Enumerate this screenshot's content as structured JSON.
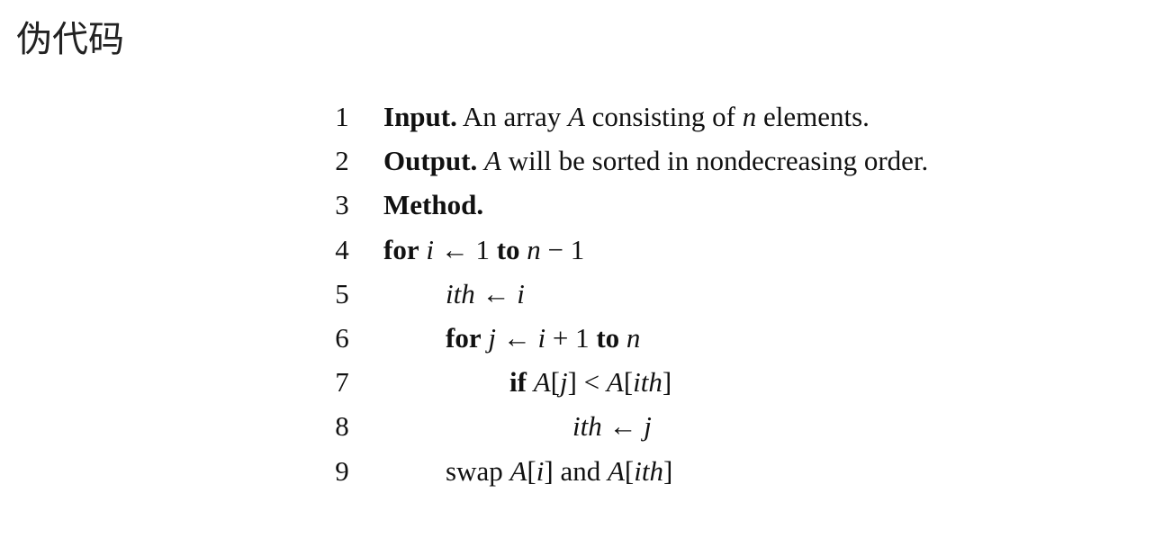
{
  "title": "伪代码",
  "lines": [
    {
      "num": "1",
      "kw": "Input.",
      "rest": " An array ",
      "v1": "A",
      "rest2": " consisting of ",
      "v2": "n",
      "rest3": " elements."
    },
    {
      "num": "2",
      "kw": "Output.",
      "v1": "A",
      "rest": " will be sorted in nondecreasing order."
    },
    {
      "num": "3",
      "kw": "Method."
    },
    {
      "num": "4",
      "kw_for": "for",
      "var": "i",
      "arrow": "←",
      "start": "1",
      "kw_to": "to",
      "end_var": "n",
      "minus": "−",
      "end_num": "1"
    },
    {
      "num": "5",
      "lhs": "ith",
      "arrow": "←",
      "rhs": "i"
    },
    {
      "num": "6",
      "kw_for": "for",
      "var": "j",
      "arrow": "←",
      "start_var": "i",
      "plus": "+",
      "start_num": "1",
      "kw_to": "to",
      "end_var": "n"
    },
    {
      "num": "7",
      "kw_if": "if",
      "arr": "A",
      "idx": "j",
      "op": "<",
      "arr2": "A",
      "idx2": "ith"
    },
    {
      "num": "8",
      "lhs": "ith",
      "arrow": "←",
      "rhs": "j"
    },
    {
      "num": "9",
      "word_swap": "swap",
      "arr": "A",
      "idx": "i",
      "word_and": "and",
      "arr2": "A",
      "idx2": "ith"
    }
  ]
}
